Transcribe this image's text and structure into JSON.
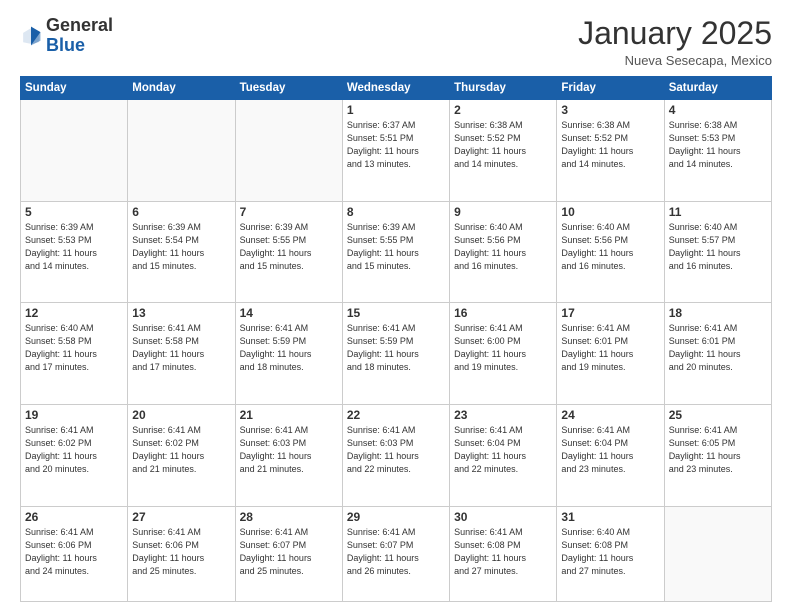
{
  "header": {
    "logo_general": "General",
    "logo_blue": "Blue",
    "month_title": "January 2025",
    "location": "Nueva Sesecapa, Mexico"
  },
  "weekdays": [
    "Sunday",
    "Monday",
    "Tuesday",
    "Wednesday",
    "Thursday",
    "Friday",
    "Saturday"
  ],
  "weeks": [
    [
      {
        "day": "",
        "info": ""
      },
      {
        "day": "",
        "info": ""
      },
      {
        "day": "",
        "info": ""
      },
      {
        "day": "1",
        "info": "Sunrise: 6:37 AM\nSunset: 5:51 PM\nDaylight: 11 hours\nand 13 minutes."
      },
      {
        "day": "2",
        "info": "Sunrise: 6:38 AM\nSunset: 5:52 PM\nDaylight: 11 hours\nand 14 minutes."
      },
      {
        "day": "3",
        "info": "Sunrise: 6:38 AM\nSunset: 5:52 PM\nDaylight: 11 hours\nand 14 minutes."
      },
      {
        "day": "4",
        "info": "Sunrise: 6:38 AM\nSunset: 5:53 PM\nDaylight: 11 hours\nand 14 minutes."
      }
    ],
    [
      {
        "day": "5",
        "info": "Sunrise: 6:39 AM\nSunset: 5:53 PM\nDaylight: 11 hours\nand 14 minutes."
      },
      {
        "day": "6",
        "info": "Sunrise: 6:39 AM\nSunset: 5:54 PM\nDaylight: 11 hours\nand 15 minutes."
      },
      {
        "day": "7",
        "info": "Sunrise: 6:39 AM\nSunset: 5:55 PM\nDaylight: 11 hours\nand 15 minutes."
      },
      {
        "day": "8",
        "info": "Sunrise: 6:39 AM\nSunset: 5:55 PM\nDaylight: 11 hours\nand 15 minutes."
      },
      {
        "day": "9",
        "info": "Sunrise: 6:40 AM\nSunset: 5:56 PM\nDaylight: 11 hours\nand 16 minutes."
      },
      {
        "day": "10",
        "info": "Sunrise: 6:40 AM\nSunset: 5:56 PM\nDaylight: 11 hours\nand 16 minutes."
      },
      {
        "day": "11",
        "info": "Sunrise: 6:40 AM\nSunset: 5:57 PM\nDaylight: 11 hours\nand 16 minutes."
      }
    ],
    [
      {
        "day": "12",
        "info": "Sunrise: 6:40 AM\nSunset: 5:58 PM\nDaylight: 11 hours\nand 17 minutes."
      },
      {
        "day": "13",
        "info": "Sunrise: 6:41 AM\nSunset: 5:58 PM\nDaylight: 11 hours\nand 17 minutes."
      },
      {
        "day": "14",
        "info": "Sunrise: 6:41 AM\nSunset: 5:59 PM\nDaylight: 11 hours\nand 18 minutes."
      },
      {
        "day": "15",
        "info": "Sunrise: 6:41 AM\nSunset: 5:59 PM\nDaylight: 11 hours\nand 18 minutes."
      },
      {
        "day": "16",
        "info": "Sunrise: 6:41 AM\nSunset: 6:00 PM\nDaylight: 11 hours\nand 19 minutes."
      },
      {
        "day": "17",
        "info": "Sunrise: 6:41 AM\nSunset: 6:01 PM\nDaylight: 11 hours\nand 19 minutes."
      },
      {
        "day": "18",
        "info": "Sunrise: 6:41 AM\nSunset: 6:01 PM\nDaylight: 11 hours\nand 20 minutes."
      }
    ],
    [
      {
        "day": "19",
        "info": "Sunrise: 6:41 AM\nSunset: 6:02 PM\nDaylight: 11 hours\nand 20 minutes."
      },
      {
        "day": "20",
        "info": "Sunrise: 6:41 AM\nSunset: 6:02 PM\nDaylight: 11 hours\nand 21 minutes."
      },
      {
        "day": "21",
        "info": "Sunrise: 6:41 AM\nSunset: 6:03 PM\nDaylight: 11 hours\nand 21 minutes."
      },
      {
        "day": "22",
        "info": "Sunrise: 6:41 AM\nSunset: 6:03 PM\nDaylight: 11 hours\nand 22 minutes."
      },
      {
        "day": "23",
        "info": "Sunrise: 6:41 AM\nSunset: 6:04 PM\nDaylight: 11 hours\nand 22 minutes."
      },
      {
        "day": "24",
        "info": "Sunrise: 6:41 AM\nSunset: 6:04 PM\nDaylight: 11 hours\nand 23 minutes."
      },
      {
        "day": "25",
        "info": "Sunrise: 6:41 AM\nSunset: 6:05 PM\nDaylight: 11 hours\nand 23 minutes."
      }
    ],
    [
      {
        "day": "26",
        "info": "Sunrise: 6:41 AM\nSunset: 6:06 PM\nDaylight: 11 hours\nand 24 minutes."
      },
      {
        "day": "27",
        "info": "Sunrise: 6:41 AM\nSunset: 6:06 PM\nDaylight: 11 hours\nand 25 minutes."
      },
      {
        "day": "28",
        "info": "Sunrise: 6:41 AM\nSunset: 6:07 PM\nDaylight: 11 hours\nand 25 minutes."
      },
      {
        "day": "29",
        "info": "Sunrise: 6:41 AM\nSunset: 6:07 PM\nDaylight: 11 hours\nand 26 minutes."
      },
      {
        "day": "30",
        "info": "Sunrise: 6:41 AM\nSunset: 6:08 PM\nDaylight: 11 hours\nand 27 minutes."
      },
      {
        "day": "31",
        "info": "Sunrise: 6:40 AM\nSunset: 6:08 PM\nDaylight: 11 hours\nand 27 minutes."
      },
      {
        "day": "",
        "info": ""
      }
    ]
  ]
}
